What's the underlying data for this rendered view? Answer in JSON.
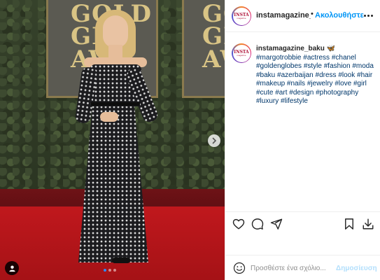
{
  "photo": {
    "board_left_text": [
      "GOLD",
      "GLO",
      "AW"
    ],
    "board_right_text": [
      "GO",
      "GL",
      "AW"
    ],
    "carousel": {
      "count": 3,
      "active_index": 0
    }
  },
  "header": {
    "avatar_brand": "INSTA",
    "avatar_sub": "magazine",
    "username": "instamagazine_baku",
    "separator": "•",
    "follow_label": "Ακολουθήστε"
  },
  "caption": {
    "username": "instamagazine_baku",
    "emoji": "🦋",
    "hashtags": [
      "#margotrobbie",
      "#actress",
      "#chanel",
      "#goldenglobes",
      "#style",
      "#fashion",
      "#moda",
      "#baku",
      "#azerbaijan",
      "#dress",
      "#look",
      "#hair",
      "#makeup",
      "#nails",
      "#jewelry",
      "#love",
      "#girl",
      "#cute",
      "#art",
      "#design",
      "#photography",
      "#luxury",
      "#lifestyle"
    ]
  },
  "actions": {
    "like_icon": "heart-icon",
    "comment_icon": "comment-icon",
    "share_icon": "paper-plane-icon",
    "save_icon": "bookmark-icon",
    "download_icon": "download-icon"
  },
  "comment_bar": {
    "placeholder": "Προσθέστε ένα σχόλιο...",
    "post_label": "Δημοσίευση"
  },
  "colors": {
    "link_blue": "#0095f6",
    "hashtag_blue": "#00376b",
    "post_disabled": "#b2dffc",
    "carousel_active": "#2f8af5"
  }
}
